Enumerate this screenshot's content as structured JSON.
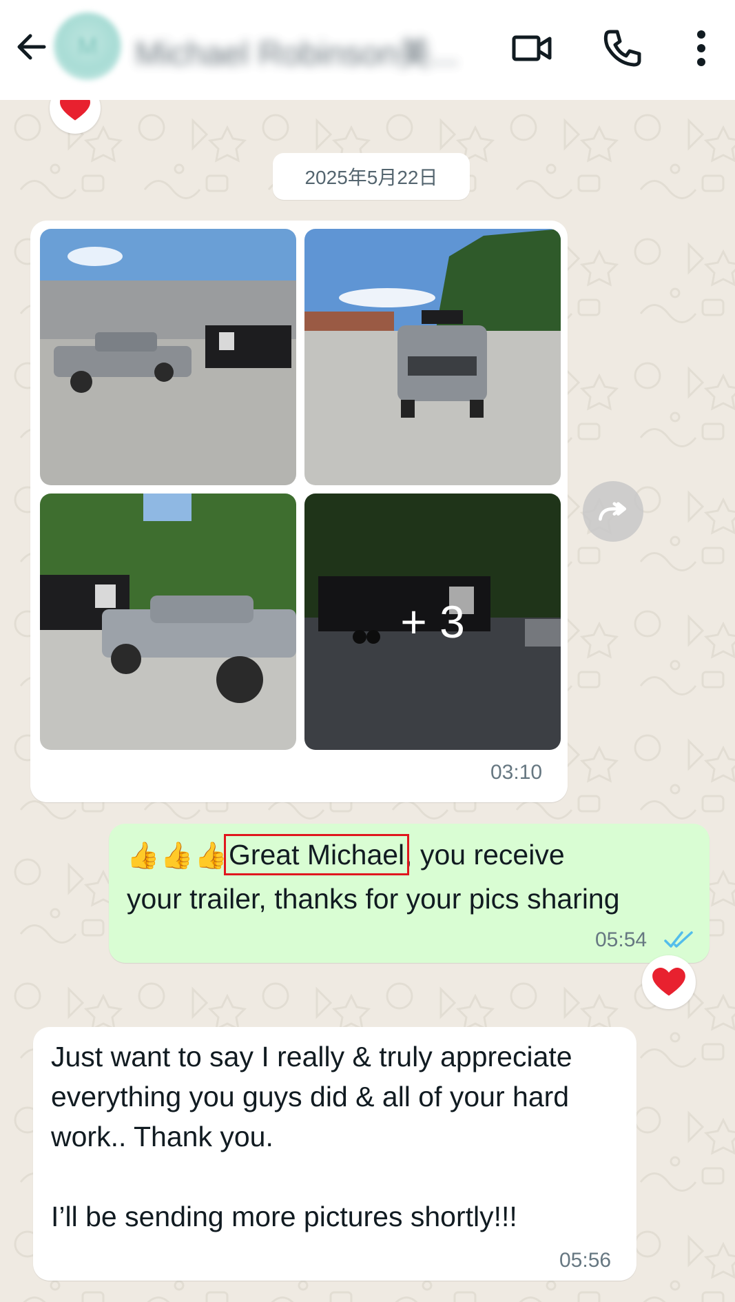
{
  "header": {
    "contact_name": "Michael Robinson美...",
    "avatar_initial": "M",
    "icons": [
      "back-arrow-icon",
      "video-camera-icon",
      "phone-icon",
      "more-vertical-icon"
    ]
  },
  "date_separator": "2025年5月22日",
  "media_message": {
    "more_count": "+ 3",
    "time": "03:10"
  },
  "outgoing_message": {
    "emoji": "👍👍👍",
    "highlight_text": "Great Michael",
    "text_after_line1": ", you receive",
    "text_line2": "your trailer, thanks for your pics sharing",
    "time": "05:54",
    "status": "read",
    "reaction": "❤️"
  },
  "incoming_message": {
    "text": "Just want to say I really & truly appreciate everything you guys did & all of your hard work.. Thank you.\n\nI’ll be sending more pictures shortly!!!",
    "time": "05:56"
  },
  "colors": {
    "chat_bg": "#efeae2",
    "outgoing_bubble": "#d9fdd3",
    "incoming_bubble": "#ffffff",
    "read_tick": "#53bdeb",
    "highlight_box": "#e0161e"
  }
}
